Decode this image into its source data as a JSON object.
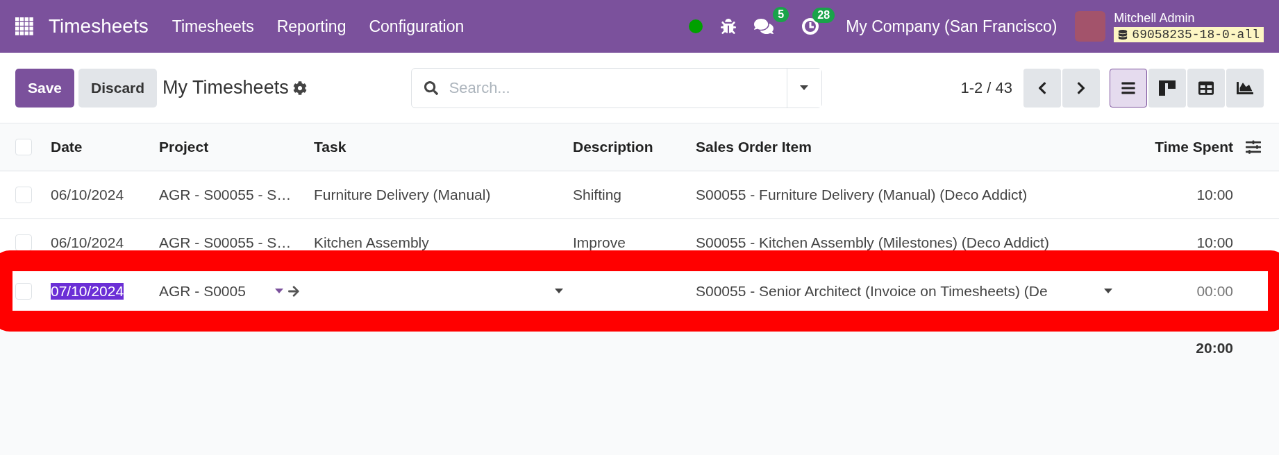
{
  "navbar": {
    "app_name": "Timesheets",
    "menu": [
      "Timesheets",
      "Reporting",
      "Configuration"
    ],
    "status_online": true,
    "messages_badge": "5",
    "activities_badge": "28",
    "company": "My Company (San Francisco)",
    "user_name": "Mitchell Admin",
    "database": "69058235-18-0-all"
  },
  "control_panel": {
    "save": "Save",
    "discard": "Discard",
    "title": "My Timesheets",
    "search": {
      "placeholder": "Search..."
    },
    "pager": "1-2 / 43",
    "views": [
      {
        "kind": "list",
        "selected": true
      },
      {
        "kind": "kanban",
        "selected": false
      },
      {
        "kind": "pivot",
        "selected": false
      },
      {
        "kind": "graph",
        "selected": false
      }
    ]
  },
  "table": {
    "select_all": {
      "checked": false
    },
    "columns": [
      "Date",
      "Project",
      "Task",
      "Description",
      "Sales Order Item",
      "Time Spent"
    ],
    "rows": [
      {
        "checked": false,
        "editing": false,
        "highlighted": false,
        "date": "06/10/2024",
        "project": "AGR - S00055 - S…",
        "task": "Furniture Delivery (Manual)",
        "description": "Shifting",
        "sales_order_item": "S00055 - Furniture Delivery (Manual) (Deco Addict)",
        "time_spent": "10:00"
      },
      {
        "checked": false,
        "editing": false,
        "highlighted": false,
        "date": "06/10/2024",
        "project": "AGR - S00055 - S…",
        "task": "Kitchen Assembly",
        "description": "Improve",
        "sales_order_item": "S00055 - Kitchen Assembly (Milestones) (Deco Addict)",
        "time_spent": "10:00"
      },
      {
        "checked": false,
        "editing": true,
        "highlighted": true,
        "date": "07/10/2024",
        "project": "AGR - S0005",
        "sales_order_item": "S00055 - Senior Architect (Invoice on Timesheets) (De",
        "time_spent": "00:00"
      }
    ],
    "total": "20:00"
  }
}
